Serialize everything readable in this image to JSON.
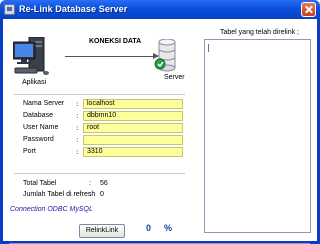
{
  "window": {
    "title": "Re-Link Database Server",
    "colors": {
      "titlebar": "#0a4fdc",
      "field_bg": "#ffff99",
      "progress": "#2b5fd9"
    }
  },
  "diagram": {
    "client_label": "Aplikasi",
    "connection_label": "KONEKSI DATA",
    "server_label": "Server"
  },
  "fields": [
    {
      "key": "Nama Server",
      "value": "localhost"
    },
    {
      "key": "Database",
      "value": "dbbmn10"
    },
    {
      "key": "User Name",
      "value": "root"
    },
    {
      "key": "Password",
      "value": ""
    },
    {
      "key": "Port",
      "value": "3310"
    }
  ],
  "separator": ":",
  "stats": [
    {
      "key": "Total Tabel",
      "value": "56"
    },
    {
      "key": "Jumlah Tabel di refresh",
      "value": "0"
    }
  ],
  "status": "Connection ODBC MySQL",
  "relink_button": "RelinkLink",
  "progress": {
    "value": "0",
    "unit": "%",
    "fraction": 0.02
  },
  "right_panel": {
    "title": "Tabel yang telah direlink ;"
  },
  "icons": [
    "app-window-icon",
    "close-icon",
    "computer-icon",
    "database-server-icon",
    "arrow-icon"
  ]
}
